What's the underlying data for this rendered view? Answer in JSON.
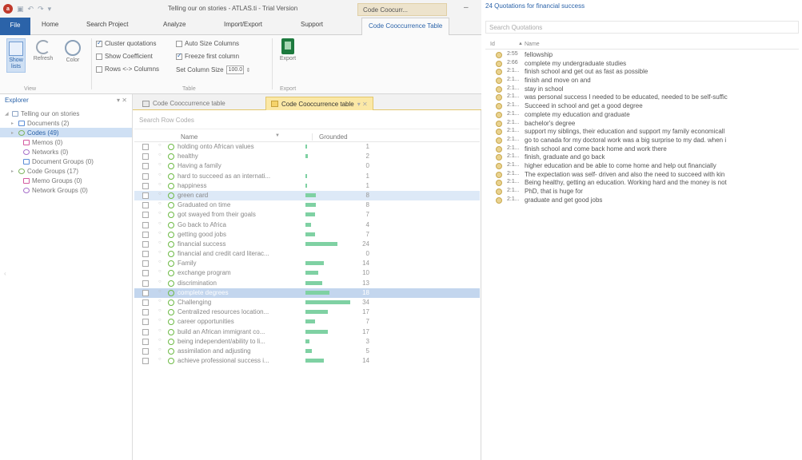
{
  "window": {
    "title": "Telling our on stories - ATLAS.ti - Trial Version",
    "context_tab": "Code Coocurr...",
    "minimize": "–"
  },
  "ribbon_tabs": [
    "File",
    "Home",
    "Search Project",
    "Analyze",
    "Import/Export",
    "Support",
    "Code Cooccurrence Table"
  ],
  "ribbon": {
    "show_lists": "Show lists",
    "refresh": "Refresh",
    "color": "Color",
    "view_group": "View",
    "cluster_quotations": "Cluster quotations",
    "show_coefficient": "Show Coefficient",
    "rows_columns": "Rows <-> Columns",
    "auto_size_columns": "Auto Size Columns",
    "freeze_first_column": "Freeze first column",
    "set_column_size": "Set Column Size",
    "column_size_value": "100.0",
    "table_group": "Table",
    "export": "Export",
    "export_group": "Export"
  },
  "explorer": {
    "title": "Explorer",
    "controls": "▾ ✕",
    "items": [
      {
        "label": "Telling our on stories",
        "icon": "project",
        "expand": "◢"
      },
      {
        "label": "Documents (2)",
        "icon": "doc",
        "expand": "▸"
      },
      {
        "label": "Codes (49)",
        "icon": "code",
        "expand": "▸"
      },
      {
        "label": "Memos (0)",
        "icon": "memo",
        "expand": ""
      },
      {
        "label": "Networks (0)",
        "icon": "net",
        "expand": ""
      },
      {
        "label": "Document Groups (0)",
        "icon": "doc",
        "expand": ""
      },
      {
        "label": "Code Groups (17)",
        "icon": "grp",
        "expand": "▸"
      },
      {
        "label": "Memo Groups (0)",
        "icon": "memo",
        "expand": ""
      },
      {
        "label": "Network Groups (0)",
        "icon": "net",
        "expand": ""
      }
    ]
  },
  "doc_tabs": {
    "tab1": "Code Cooccurrence table",
    "tab2": "Code Cooccurrence table",
    "close": "▾ ✕"
  },
  "grid": {
    "search_placeholder": "Search Row Codes",
    "col_name": "Name",
    "col_grounded": "Grounded",
    "rows": [
      {
        "name": "holding onto African values",
        "grounded": "1"
      },
      {
        "name": "healthy",
        "grounded": "2"
      },
      {
        "name": "Having a family",
        "grounded": "0"
      },
      {
        "name": "hard to succeed as an internati...",
        "grounded": "1"
      },
      {
        "name": "happiness",
        "grounded": "1"
      },
      {
        "name": "green card",
        "grounded": "8"
      },
      {
        "name": "Graduated on time",
        "grounded": "8"
      },
      {
        "name": "got swayed from their goals",
        "grounded": "7"
      },
      {
        "name": "Go back to Africa",
        "grounded": "4"
      },
      {
        "name": "getting good jobs",
        "grounded": "7"
      },
      {
        "name": "financial success",
        "grounded": "24"
      },
      {
        "name": "financial and credit card literac...",
        "grounded": "0"
      },
      {
        "name": "Family",
        "grounded": "14"
      },
      {
        "name": "exchange program",
        "grounded": "10"
      },
      {
        "name": "discrimination",
        "grounded": "13"
      },
      {
        "name": "complete degrees",
        "grounded": "18"
      },
      {
        "name": "Challenging",
        "grounded": "34"
      },
      {
        "name": "Centralized resources location...",
        "grounded": "17"
      },
      {
        "name": "career opportunities",
        "grounded": "7"
      },
      {
        "name": "build an African immigrant co...",
        "grounded": "17"
      },
      {
        "name": "being independent/ability to li...",
        "grounded": "3"
      },
      {
        "name": "assimilation and adjusting",
        "grounded": "5"
      },
      {
        "name": "achieve professional success i...",
        "grounded": "14"
      }
    ]
  },
  "quotations": {
    "title": "24 Quotations for financial success",
    "search_placeholder": "Search Quotations",
    "col_id": "Id",
    "col_name": "Name",
    "rows": [
      {
        "id": "2:55",
        "text": "fellowship"
      },
      {
        "id": "2:66",
        "text": "complete my undergraduate studies"
      },
      {
        "id": "2:1...",
        "text": "finish school and get out as fast as possible"
      },
      {
        "id": "2:1...",
        "text": "finish and move on and"
      },
      {
        "id": "2:1...",
        "text": "stay in school"
      },
      {
        "id": "2:1...",
        "text": "was personal success I needed to be educated, needed to be self-suffic"
      },
      {
        "id": "2:1...",
        "text": "Succeed in school and get a good degree"
      },
      {
        "id": "2:1...",
        "text": "complete my education and graduate"
      },
      {
        "id": "2:1...",
        "text": "bachelor's degree"
      },
      {
        "id": "2:1...",
        "text": "support my siblings, their education and support my family economicall"
      },
      {
        "id": "2:1...",
        "text": "go to canada for my doctoral work was a big surprise to my dad. when i"
      },
      {
        "id": "2:1...",
        "text": "finish school and come back home and work there"
      },
      {
        "id": "2:1...",
        "text": "finish, graduate and go back"
      },
      {
        "id": "2:1...",
        "text": "higher education and be able to come home and help out financially"
      },
      {
        "id": "2:1...",
        "text": "The expectation was self- driven and also the need to succeed with kin"
      },
      {
        "id": "2:1...",
        "text": "Being healthy, getting an education. Working hard and the money is not"
      },
      {
        "id": "2:1...",
        "text": "PhD, that is huge for"
      },
      {
        "id": "2:1...",
        "text": "graduate and get good jobs"
      }
    ]
  }
}
